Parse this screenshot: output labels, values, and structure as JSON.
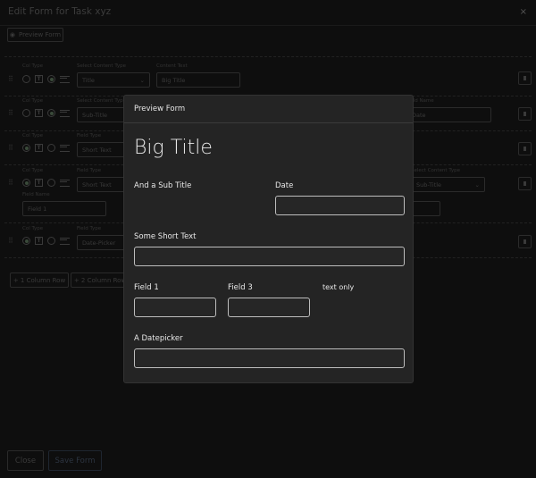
{
  "window": {
    "title": "Edit Form for Task xyz",
    "close": "×"
  },
  "toolbar": {
    "preview_label": "Preview Form"
  },
  "rows": [
    {
      "col_type_label": "Col Type",
      "select_label": "Select Content Type",
      "select_value": "Title",
      "text_label": "Content Text",
      "text_value": "Big Title"
    },
    {
      "col_type_label": "Col Type",
      "select_label": "Select Content Type",
      "select_value": "Sub-Title",
      "right_label": "Field Name",
      "right_value": "Date"
    },
    {
      "col_type_label": "Col Type",
      "select_label": "Field Type",
      "select_value": "Short Text"
    },
    {
      "col_type_label": "Col Type",
      "select_label": "Field Type",
      "select_value": "Short Text",
      "name_label": "Field Name",
      "name_value": "Field 1",
      "right_label": "Select Content Type",
      "right_value": "Sub-Title"
    },
    {
      "col_type_label": "Col Type",
      "select_label": "Field Type",
      "select_value": "Date-Picker"
    }
  ],
  "add_buttons": [
    "+ 1 Column Row",
    "+ 2 Column Row"
  ],
  "footer": {
    "close": "Close",
    "save": "Save Form"
  },
  "modal": {
    "title": "Preview Form",
    "big_title": "Big Title",
    "sub_title": "And a Sub Title",
    "date_label": "Date",
    "short_text_label": "Some Short Text",
    "field1_label": "Field 1",
    "field3_label": "Field 3",
    "text_only": "text only",
    "datepicker_label": "A Datepicker"
  }
}
